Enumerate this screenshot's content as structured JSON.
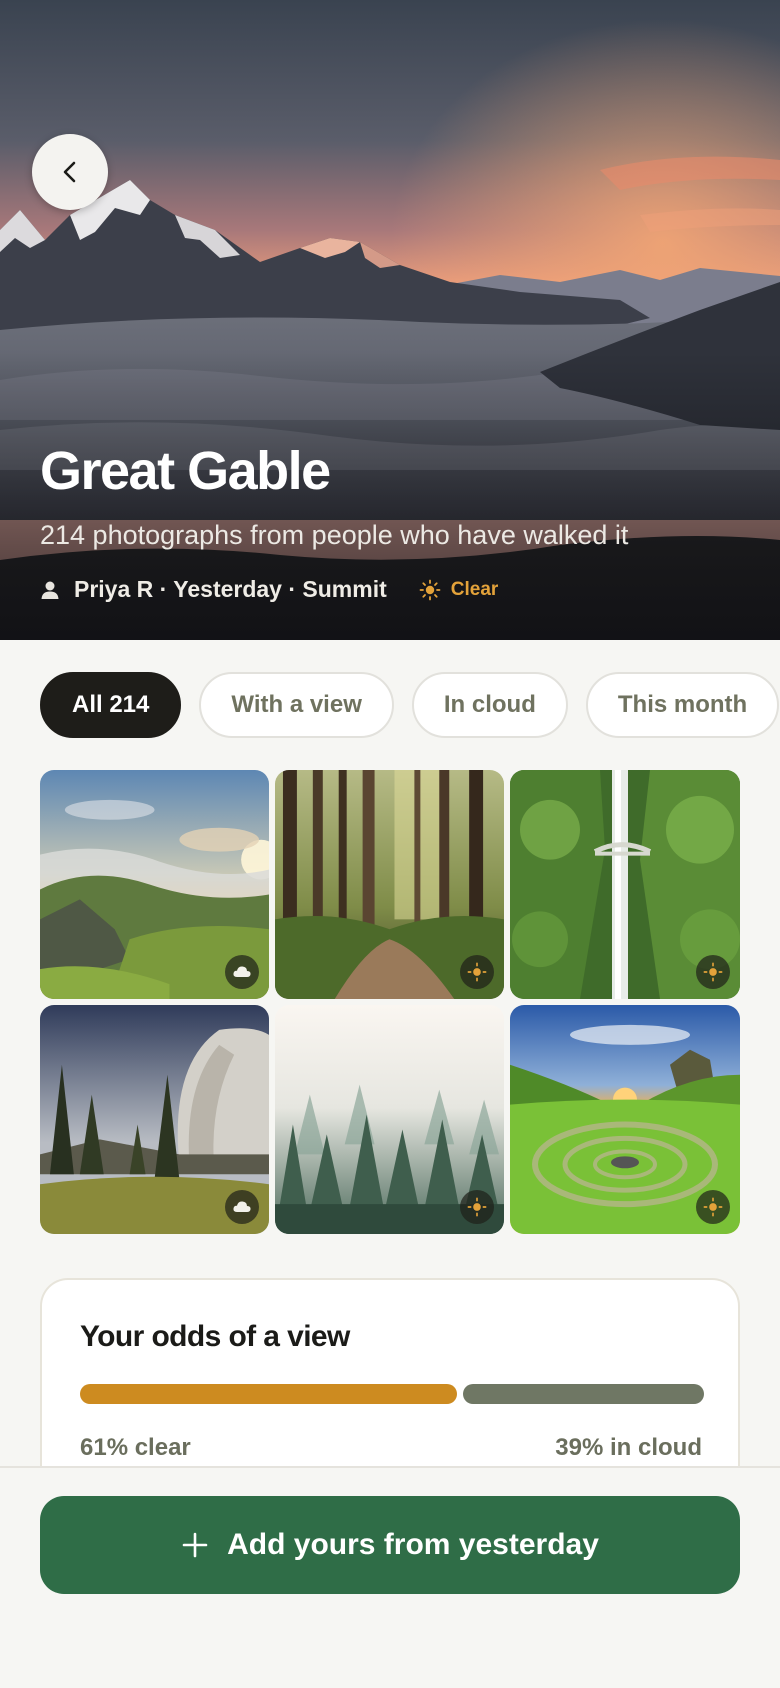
{
  "hero": {
    "title": "Great Gable",
    "subtitle": "214 photographs from people who have walked it",
    "meta": "Priya R · Yesterday · Summit",
    "weather": "Clear"
  },
  "filters": [
    {
      "label": "All 214",
      "active": true
    },
    {
      "label": "With a view",
      "active": false
    },
    {
      "label": "In cloud",
      "active": false
    },
    {
      "label": "This month",
      "active": false
    }
  ],
  "photos": [
    {
      "scene": "misty green valley at sunrise",
      "condition": "cloud"
    },
    {
      "scene": "forest path with tall trees",
      "condition": "clear"
    },
    {
      "scene": "waterfall with stone bridge",
      "condition": "clear"
    },
    {
      "scene": "granite cliff above meadow",
      "condition": "cloud"
    },
    {
      "scene": "fog over pine forest",
      "condition": "clear"
    },
    {
      "scene": "spiral stones in green valley at sunset",
      "condition": "clear"
    }
  ],
  "odds": {
    "title": "Your odds of a view",
    "clear_fraction": 0.61,
    "cloud_fraction": 0.39,
    "clear_label": "61% clear",
    "cloud_label": "39% in cloud"
  },
  "cta": {
    "label": "Add yours from yesterday"
  },
  "colors": {
    "accent": "#cd8b20",
    "cloud": "#6f7764",
    "cta": "#2f6d47"
  }
}
